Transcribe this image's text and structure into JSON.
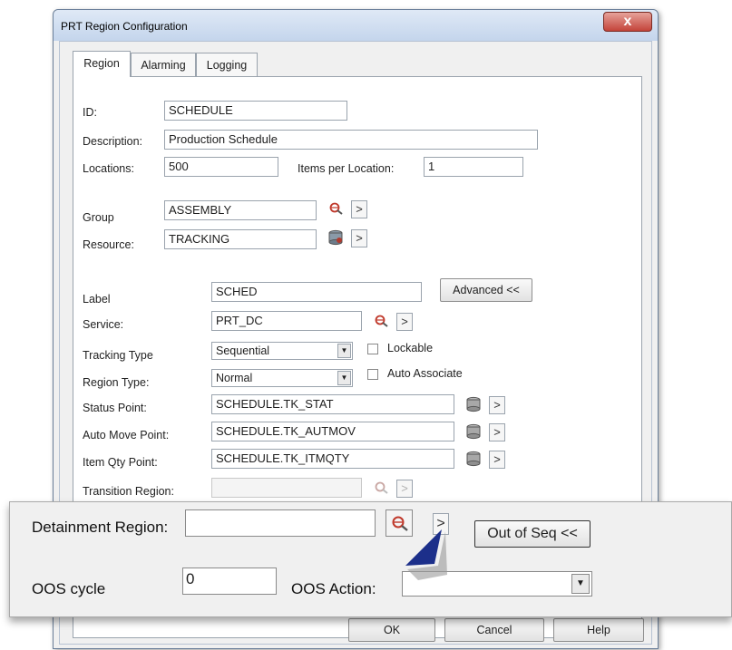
{
  "window": {
    "title": "PRT Region Configuration",
    "close_glyph": "x"
  },
  "tabs": [
    {
      "label": "Region",
      "active": true
    },
    {
      "label": "Alarming",
      "active": false
    },
    {
      "label": "Logging",
      "active": false
    }
  ],
  "form": {
    "id_label": "ID:",
    "id_value": "SCHEDULE",
    "description_label": "Description:",
    "description_value": "Production Schedule",
    "locations_label": "Locations:",
    "locations_value": "500",
    "items_per_location_label": "Items per Location:",
    "items_per_location_value": "1",
    "group_label": "Group",
    "group_value": "ASSEMBLY",
    "resource_label": "Resource:",
    "resource_value": "TRACKING",
    "arrow_glyph": ">",
    "label_label": "Label",
    "label_value": "SCHED",
    "advanced_button": "Advanced <<",
    "service_label": "Service:",
    "service_value": "PRT_DC",
    "tracking_type_label": "Tracking Type",
    "tracking_type_value": "Sequential",
    "lockable_label": "Lockable",
    "region_type_label": "Region Type:",
    "region_type_value": "Normal",
    "auto_associate_label": "Auto Associate",
    "status_point_label": "Status Point:",
    "status_point_value": "SCHEDULE.TK_STAT",
    "auto_move_point_label": "Auto Move Point:",
    "auto_move_point_value": "SCHEDULE.TK_AUTMOV",
    "item_qty_point_label": "Item Qty Point:",
    "item_qty_point_value": "SCHEDULE.TK_ITMQTY",
    "transition_region_label": "Transition Region:",
    "transition_region_value": ""
  },
  "bottom_buttons": {
    "ok": "OK",
    "cancel": "Cancel",
    "help": "Help"
  },
  "overlay": {
    "detainment_region_label": "Detainment Region:",
    "detainment_region_value": "",
    "arrow_glyph": ">",
    "out_of_seq_button": "Out of Seq <<",
    "oos_cycle_label": "OOS cycle",
    "oos_cycle_value": "0",
    "oos_action_label": "OOS Action:",
    "oos_action_value": ""
  },
  "icons": {
    "search": "magnifier-icon",
    "database": "database-icon",
    "pointer": "pointer-arrow-icon"
  },
  "colors": {
    "pointer_arrow": "#1c2f8a",
    "close_button": "#c4443a"
  }
}
